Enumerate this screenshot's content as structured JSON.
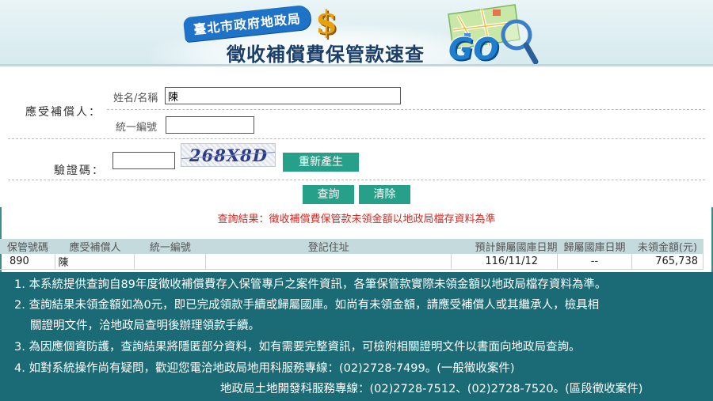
{
  "banner": {
    "agency": "臺北市政府地政局",
    "title": "徵收補償費保管款速查",
    "go": "GO",
    "dollar_symbol": "$"
  },
  "form": {
    "recipient_label": "應受補償人：",
    "name_label": "姓名/名稱",
    "name_value": "陳",
    "taxid_label": "統一編號",
    "taxid_value": "",
    "captcha_label": "驗證碼：",
    "captcha_input_value": "",
    "captcha_text": "268X8D",
    "regenerate_button": "重新產生",
    "search_button": "查詢",
    "clear_button": "清除"
  },
  "result_notice": "查詢結果：徵收補償費保管款未領金額以地政局檔存資料為準",
  "table": {
    "headers": [
      "保管號碼",
      "應受補償人",
      "統一編號",
      "登記住址",
      "預計歸屬國庫日期",
      "歸屬國庫日期",
      "未領金額(元)"
    ],
    "rows": [
      [
        "890",
        "陳",
        "",
        "",
        "116/11/12",
        "--",
        "765,738"
      ]
    ]
  },
  "info_lines": [
    "1. 本系統提供查詢自89年度徵收補償費存入保管專戶之案件資訊，各筆保管款實際未領金額以地政局檔存資料為準。",
    "2. 查詢結果未領金額如為0元，即已完成領款手續或歸屬國庫。如尚有未領金額，請應受補償人或其繼承人，檢具相",
    "關證明文件，洽地政局查明後辦理領款手續。",
    "3. 為因應個資防護，查詢結果將隱匿部分資料，如有需要完整資訊，可檢附相關證明文件以書面向地政局查詢。",
    "4. 如對系統操作尚有疑問，歡迎您電洽地政局地用科服務專線：(02)2728-7499。(一般徵收案件)",
    "地政局土地開發科服務專線：(02)2728-7512、(02)2728-7520。(區段徵收案件)"
  ],
  "colors": {
    "button": "#27a08a",
    "info_bg": "#1a6b75",
    "notice": "#d8261f",
    "table_header": "#c4dadd"
  }
}
